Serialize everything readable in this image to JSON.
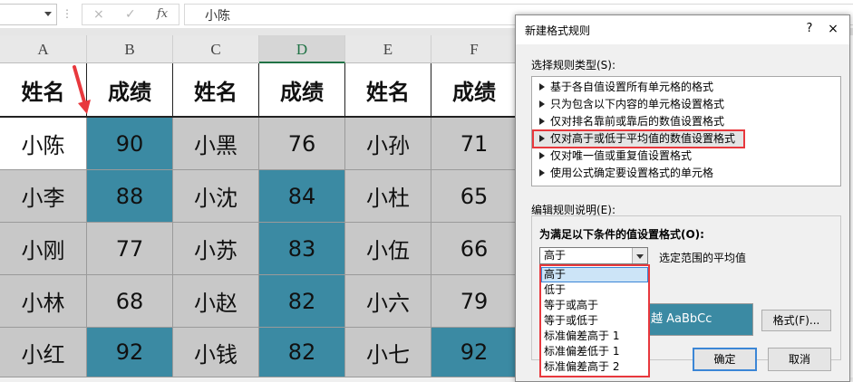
{
  "formula_bar": {
    "dots": "⋮",
    "cancel_icon": "×",
    "enter_icon": "✓",
    "fx_label": "fx",
    "content": "小陈"
  },
  "sheet": {
    "columns": [
      "A",
      "B",
      "C",
      "D",
      "E",
      "F"
    ],
    "selected_column": "D",
    "header_row": [
      "姓名",
      "成绩",
      "姓名",
      "成绩",
      "姓名",
      "成绩"
    ],
    "rows": [
      [
        "小陈",
        "90",
        "小黑",
        "76",
        "小孙",
        "71"
      ],
      [
        "小李",
        "88",
        "小沈",
        "84",
        "小杜",
        "65"
      ],
      [
        "小刚",
        "77",
        "小苏",
        "83",
        "小伍",
        "66"
      ],
      [
        "小林",
        "68",
        "小赵",
        "82",
        "小六",
        "79"
      ],
      [
        "小红",
        "92",
        "小钱",
        "82",
        "小七",
        "92"
      ]
    ],
    "colors": {
      "teal": "#3b8aa3",
      "gray": "#c8c8c8",
      "white": "#ffffff"
    }
  },
  "dialog": {
    "title": "新建格式规则",
    "help_icon": "?",
    "close_icon": "×",
    "rule_type_label": "选择规则类型(S):",
    "rule_types": [
      "基于各自值设置所有单元格的格式",
      "只为包含以下内容的单元格设置格式",
      "仅对排名靠前或靠后的数值设置格式",
      "仅对高于或低于平均值的数值设置格式",
      "仅对唯一值或重复值设置格式",
      "使用公式确定要设置格式的单元格"
    ],
    "selected_rule_index": 3,
    "edit_label": "编辑规则说明(E):",
    "condition_label": "为满足以下条件的值设置格式(O):",
    "select_value": "高于",
    "range_text": "选定范围的平均值",
    "dropdown_options": [
      "高于",
      "低于",
      "等于或高于",
      "等于或低于",
      "标准偏差高于 1",
      "标准偏差低于 1",
      "标准偏差高于 2"
    ],
    "preview_text": "越  AaBbCc",
    "format_button": "格式(F)...",
    "ok_button": "确定",
    "cancel_button": "取消",
    "accent_color": "#e8383d"
  }
}
